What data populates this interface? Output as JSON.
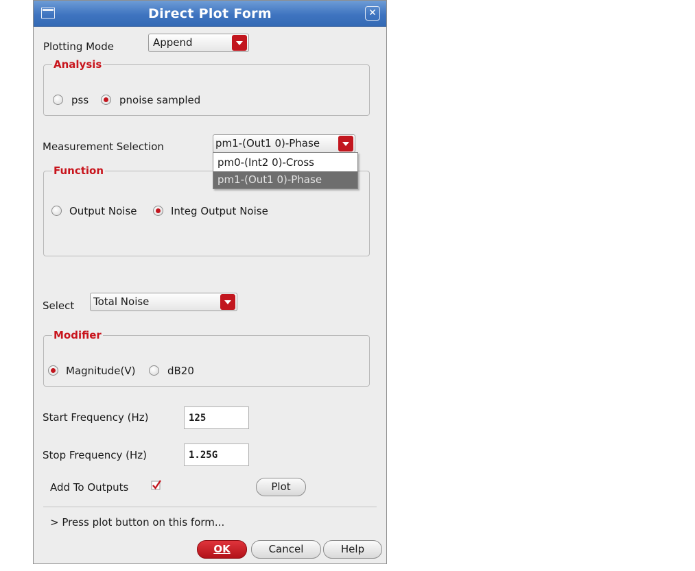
{
  "window": {
    "title": "Direct Plot Form"
  },
  "plotting_mode": {
    "label": "Plotting Mode",
    "value": "Append"
  },
  "analysis": {
    "title": "Analysis",
    "options": [
      {
        "label": "pss",
        "selected": false
      },
      {
        "label": "pnoise sampled",
        "selected": true
      }
    ]
  },
  "measurement": {
    "label": "Measurement Selection",
    "value": "pm1-(Out1 0)-Phase",
    "options": [
      "pm0-(Int2 0)-Cross",
      "pm1-(Out1 0)-Phase"
    ],
    "highlighted_option": "pm1-(Out1 0)-Phase"
  },
  "function": {
    "title": "Function",
    "options": [
      {
        "label": "Output Noise",
        "selected": false
      },
      {
        "label": "Integ Output Noise",
        "selected": true
      }
    ]
  },
  "select": {
    "label": "Select",
    "value": "Total Noise"
  },
  "modifier": {
    "title": "Modifier",
    "options": [
      {
        "label": "Magnitude(V)",
        "selected": true
      },
      {
        "label": "dB20",
        "selected": false
      }
    ]
  },
  "start_frequency": {
    "label": "Start Frequency (Hz)",
    "value": "125"
  },
  "stop_frequency": {
    "label": "Stop Frequency (Hz)",
    "value": "1.25G"
  },
  "add_to_outputs": {
    "label": "Add To Outputs",
    "checked": true
  },
  "plot_button": {
    "label": "Plot"
  },
  "status": {
    "text": "> Press plot button on this form..."
  },
  "buttons": {
    "ok": {
      "label": "OK"
    },
    "cancel": {
      "label": "Cancel"
    },
    "help": {
      "label": "Help"
    }
  },
  "colors": {
    "accent": "#c2161e",
    "titlebar": "#3f74c0",
    "background": "#ededed"
  }
}
